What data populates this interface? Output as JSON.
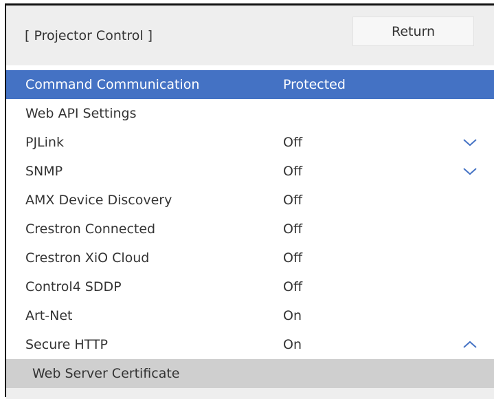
{
  "header": {
    "title": "[ Projector Control ]",
    "return_label": "Return"
  },
  "menu": {
    "items": [
      {
        "label": "Command Communication",
        "value": "Protected",
        "selected": true
      },
      {
        "label": "Web API Settings",
        "value": ""
      },
      {
        "label": "PJLink",
        "value": "Off",
        "expander": "chevron-down"
      },
      {
        "label": "SNMP",
        "value": "Off",
        "expander": "chevron-down"
      },
      {
        "label": "AMX Device Discovery",
        "value": "Off"
      },
      {
        "label": "Crestron Connected",
        "value": "Off"
      },
      {
        "label": "Crestron XiO Cloud",
        "value": "Off"
      },
      {
        "label": "Control4 SDDP",
        "value": "Off"
      },
      {
        "label": "Art-Net",
        "value": "On"
      },
      {
        "label": "Secure HTTP",
        "value": "On",
        "expander": "chevron-up"
      }
    ],
    "subitem": {
      "label": "Web Server Certificate"
    }
  },
  "colors": {
    "selected_row": "#4472c4",
    "chevron": "#4472c4",
    "header_background": "#eeeeee",
    "subitem_background": "#cfcfcf"
  }
}
